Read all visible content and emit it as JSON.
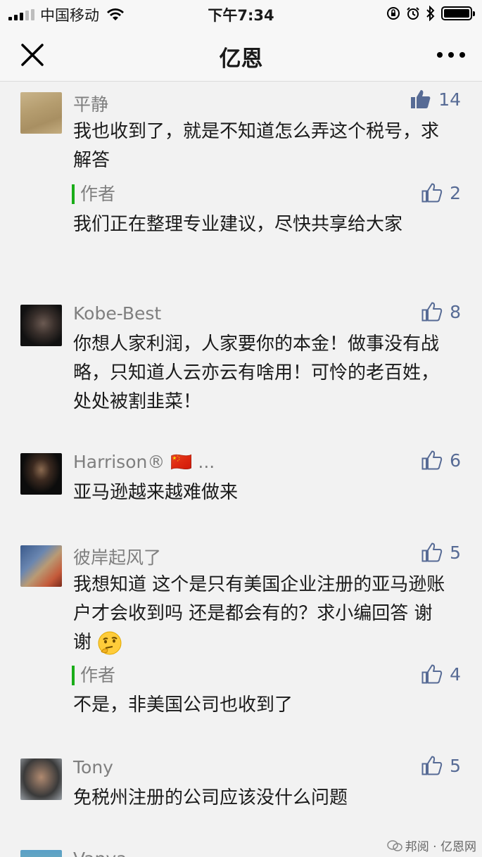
{
  "status_bar": {
    "carrier": "中国移动",
    "time": "下午7:34"
  },
  "nav": {
    "title": "亿恩"
  },
  "comments": [
    {
      "user": "平静",
      "likes": "14",
      "liked": true,
      "text": "我也收到了，就是不知道怎么弄这个税号，求解答",
      "reply": {
        "label": "作者",
        "likes": "2",
        "text": "我们正在整理专业建议，尽快共享给大家"
      }
    },
    {
      "user": "Kobe-Best",
      "likes": "8",
      "text": "你想人家利润，人家要你的本金！做事没有战略，只知道人云亦云有啥用！可怜的老百姓，处处被割韭菜！"
    },
    {
      "user": "Harrison® 🇨🇳 ...",
      "likes": "6",
      "text": "亚马逊越来越难做来"
    },
    {
      "user": "彼岸起风了",
      "likes": "5",
      "text": "我想知道 这个是只有美国企业注册的亚马逊账户才会收到吗 还是都会有的？求小编回答 谢谢",
      "reply": {
        "label": "作者",
        "likes": "4",
        "text": "不是，非美国公司也收到了"
      }
    },
    {
      "user": "Tony",
      "likes": "5",
      "text": "免税州注册的公司应该没什么问题"
    },
    {
      "user": "Vanya",
      "likes": ""
    }
  ],
  "watermark": "邦阅 · 亿恩网",
  "icons": {
    "close": "close-icon",
    "more": "more-icon",
    "like": "thumbs-up-icon",
    "like_filled": "thumbs-up-filled-icon"
  },
  "colors": {
    "link": "#576b95",
    "author_bar": "#1aad19",
    "username": "#7f7f7f"
  }
}
